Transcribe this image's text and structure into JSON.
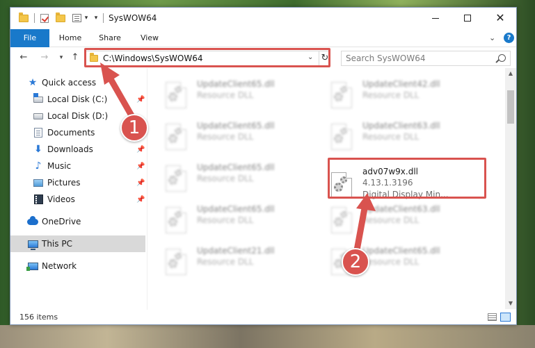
{
  "window": {
    "title": "SysWOW64"
  },
  "ribbon": {
    "tabs": [
      {
        "label": "File"
      },
      {
        "label": "Home"
      },
      {
        "label": "Share"
      },
      {
        "label": "View"
      }
    ]
  },
  "address": {
    "path": "C:\\Windows\\SysWOW64"
  },
  "search": {
    "placeholder": "Search SysWOW64"
  },
  "sidebar": {
    "items": [
      {
        "label": "Quick access",
        "icon": "star-icon"
      },
      {
        "label": "Local Disk (C:)",
        "icon": "drive-icon",
        "pinned": true
      },
      {
        "label": "Local Disk (D:)",
        "icon": "drive-icon",
        "pinned": false
      },
      {
        "label": "Documents",
        "icon": "documents-icon",
        "pinned": true
      },
      {
        "label": "Downloads",
        "icon": "download-icon",
        "pinned": true
      },
      {
        "label": "Music",
        "icon": "music-icon",
        "pinned": true
      },
      {
        "label": "Pictures",
        "icon": "pictures-icon",
        "pinned": true
      },
      {
        "label": "Videos",
        "icon": "videos-icon",
        "pinned": true
      },
      {
        "label": "OneDrive",
        "icon": "cloud-icon"
      },
      {
        "label": "This PC",
        "icon": "computer-icon",
        "selected": true
      },
      {
        "label": "Network",
        "icon": "network-icon"
      }
    ]
  },
  "files": [
    {
      "name": "UpdateClient65.dll",
      "desc": "Resource DLL"
    },
    {
      "name": "UpdateClient42.dll",
      "desc": "Resource DLL"
    },
    {
      "name": "UpdateClient65.dll",
      "desc": "Resource DLL"
    },
    {
      "name": "UpdateClient63.dll",
      "desc": "Resource DLL"
    },
    {
      "name": "UpdateClient65.dll",
      "desc": "Resource DLL"
    },
    {
      "name": "adv07w9x.dll",
      "version": "4.13.1.3196",
      "desc": "Digital Display Min..."
    },
    {
      "name": "UpdateClient65.dll",
      "desc": "Resource DLL"
    },
    {
      "name": "UpdateClient63.dll",
      "desc": "Resource DLL"
    },
    {
      "name": "UpdateClient21.dll",
      "desc": "Resource DLL"
    },
    {
      "name": "UpdateClient65.dll",
      "desc": "Resource DLL"
    }
  ],
  "status": {
    "item_count": "156 items"
  },
  "annotations": {
    "step1": "1",
    "step2": "2"
  },
  "colors": {
    "accent": "#1979ca",
    "highlight": "#d9534f"
  }
}
